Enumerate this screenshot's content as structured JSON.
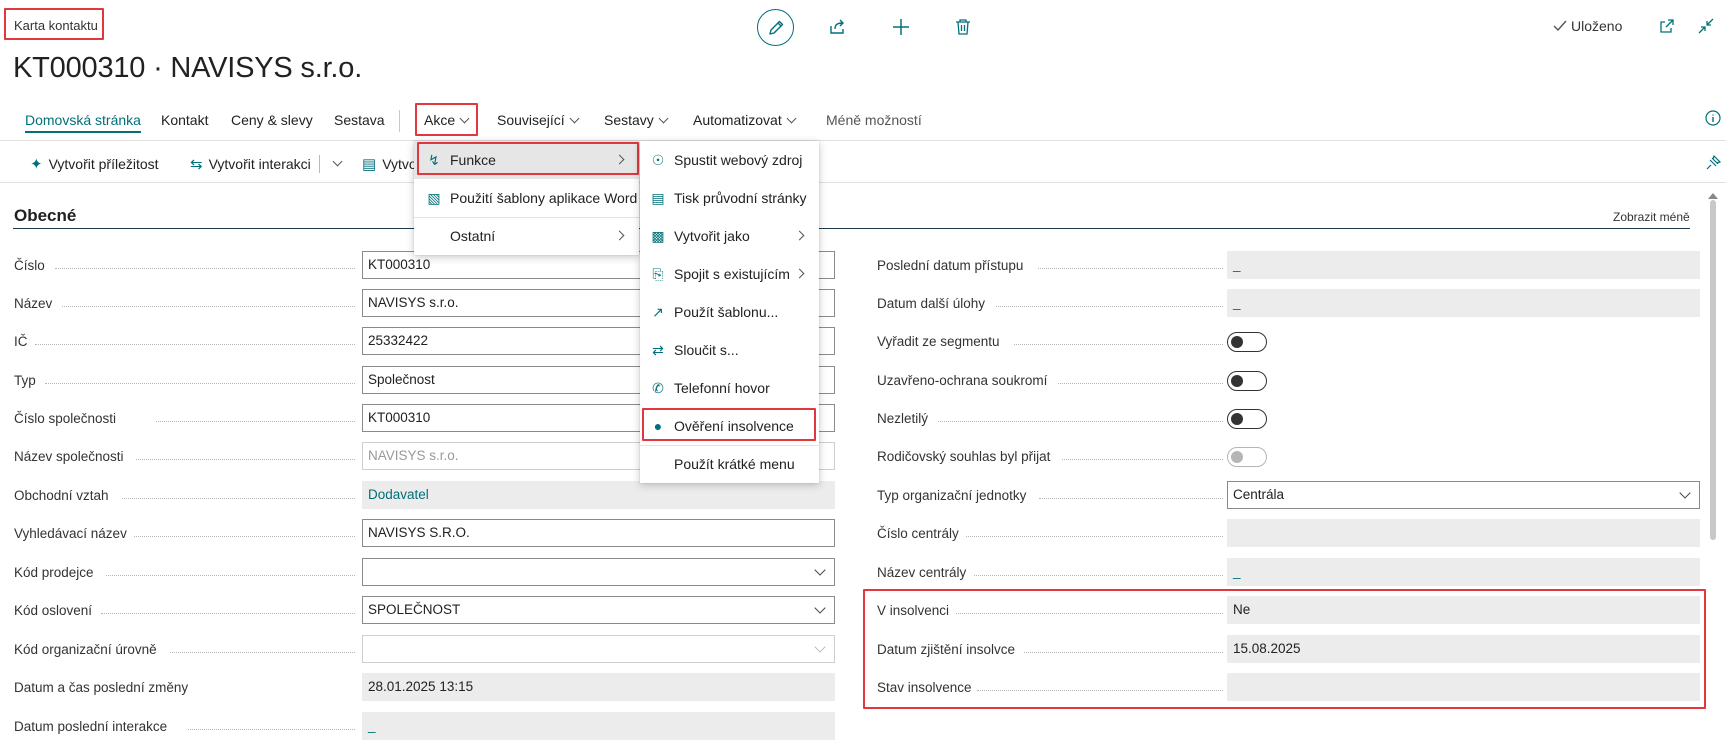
{
  "breadcrumb": "Karta kontaktu",
  "page_title": "KT000310 · NAVISYS s.r.o.",
  "top_actions": {
    "saved_label": "Uloženo"
  },
  "nav": {
    "home": "Domovská stránka",
    "contact": "Kontakt",
    "prices": "Ceny & slevy",
    "report": "Sestava",
    "actions": "Akce",
    "related": "Související",
    "reports": "Sestavy",
    "automate": "Automatizovat",
    "fewer": "Méně možností"
  },
  "action_bar": {
    "create_opportunity": "Vytvořit příležitost",
    "create_interaction": "Vytvořit interakci",
    "create_truncated": "Vytvo"
  },
  "menu_actions": {
    "functions": "Funkce",
    "word_template": "Použití šablony aplikace Word",
    "other": "Ostatní"
  },
  "menu_functions": {
    "items": [
      "Spustit webový zdroj",
      "Tisk průvodní stránky",
      "Vytvořit jako",
      "Spojit s existujícím",
      "Použít šablonu...",
      "Sloučit s...",
      "Telefonní hovor",
      "Ověření insolvence",
      "Použít krátké menu"
    ]
  },
  "section": {
    "title": "Obecné",
    "show_less": "Zobrazit méně"
  },
  "left_fields": [
    {
      "label": "Číslo",
      "value": "KT000310"
    },
    {
      "label": "Název",
      "value": "NAVISYS s.r.o."
    },
    {
      "label": "IČ",
      "value": "25332422"
    },
    {
      "label": "Typ",
      "value": "Společnost"
    },
    {
      "label": "Číslo společnosti",
      "value": "KT000310"
    },
    {
      "label": "Název společnosti",
      "value": "NAVISYS s.r.o."
    },
    {
      "label": "Obchodní vztah",
      "value": "Dodavatel"
    },
    {
      "label": "Vyhledávací název",
      "value": "NAVISYS S.R.O."
    },
    {
      "label": "Kód prodejce",
      "value": ""
    },
    {
      "label": "Kód oslovení",
      "value": "SPOLEČNOST"
    },
    {
      "label": "Kód organizační úrovně",
      "value": ""
    },
    {
      "label": "Datum a čas poslední změny",
      "value": "28.01.2025 13:15"
    },
    {
      "label": "Datum poslední interakce",
      "value": "_"
    }
  ],
  "right_fields": [
    {
      "label": "Poslední datum přístupu",
      "value": "_"
    },
    {
      "label": "Datum další úlohy",
      "value": "_"
    },
    {
      "label": "Vyřadit ze segmentu",
      "value": ""
    },
    {
      "label": "Uzavřeno-ochrana soukromí",
      "value": ""
    },
    {
      "label": "Nezletilý",
      "value": ""
    },
    {
      "label": "Rodičovský souhlas byl přijat",
      "value": ""
    },
    {
      "label": "Typ organizační jednotky",
      "value": "Centrála"
    },
    {
      "label": "Číslo centrály",
      "value": ""
    },
    {
      "label": "Název centrály",
      "value": "_"
    },
    {
      "label": "V insolvenci",
      "value": "Ne"
    },
    {
      "label": "Datum zjištění insolvce",
      "value": "15.08.2025"
    },
    {
      "label": "Stav insolvence",
      "value": ""
    }
  ],
  "colors": {
    "accent": "#00707a",
    "highlight": "#e0383e",
    "readonly_bg": "#ececec"
  }
}
